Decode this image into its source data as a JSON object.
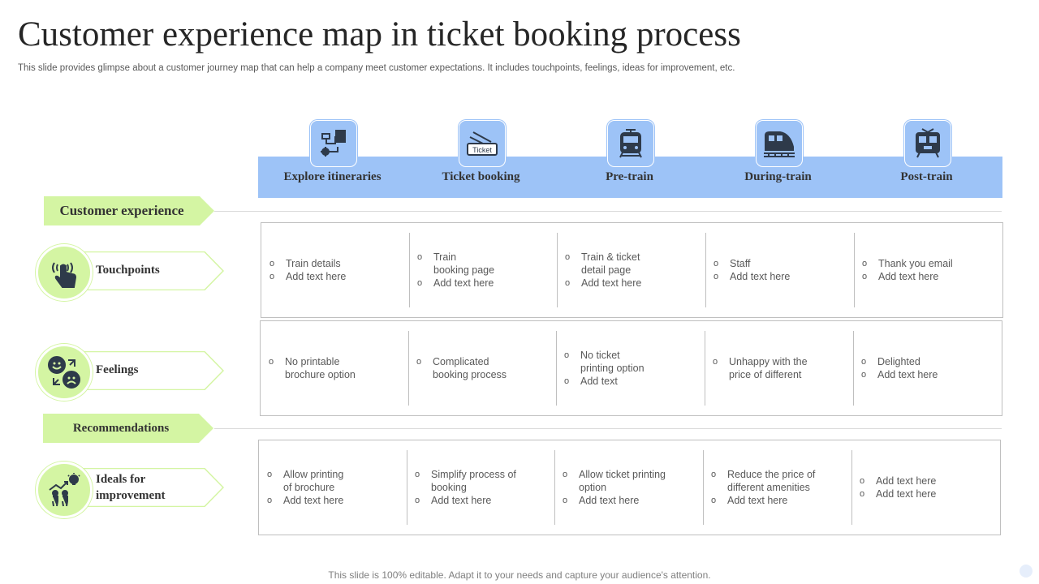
{
  "header": {
    "title": "Customer experience map in ticket booking process",
    "subtitle": "This slide provides glimpse about a customer journey map that can help a company meet customer expectations. It includes touchpoints, feelings, ideas for improvement, etc."
  },
  "stages": [
    {
      "label": "Explore itineraries",
      "icon": "itinerary-map-icon"
    },
    {
      "label": "Ticket booking",
      "icon": "ticket-icon"
    },
    {
      "label": "Pre-train",
      "icon": "train-front-icon"
    },
    {
      "label": "During-train",
      "icon": "moving-train-icon"
    },
    {
      "label": "Post-train",
      "icon": "arriving-train-icon"
    }
  ],
  "sections": {
    "customer_experience": "Customer experience",
    "recommendations": "Recommendations"
  },
  "rows": [
    {
      "label": "Touchpoints",
      "icon": "hand-touch-icon",
      "cells": [
        [
          "Train details",
          "Add text here"
        ],
        [
          "Train\nbooking page",
          "Add text here"
        ],
        [
          "Train & ticket\ndetail page",
          "Add text here"
        ],
        [
          "Staff",
          "Add text here"
        ],
        [
          "Thank you email",
          "Add text here"
        ]
      ]
    },
    {
      "label": "Feelings",
      "icon": "emotions-icon",
      "cells": [
        [
          "No printable\nbrochure option"
        ],
        [
          "Complicated\nbooking process"
        ],
        [
          "No ticket\nprinting option",
          "Add text"
        ],
        [
          "Unhappy with the\nprice of different"
        ],
        [
          "Delighted",
          "Add text here"
        ]
      ]
    },
    {
      "label": "Ideals for\nimprovement",
      "icon": "growth-people-icon",
      "cells": [
        [
          "Allow printing\nof brochure",
          "Add text here"
        ],
        [
          "Simplify process of\nbooking",
          "Add text here"
        ],
        [
          "Allow ticket printing\noption",
          "Add text here"
        ],
        [
          "Reduce the price of\ndifferent amenities",
          "Add text here"
        ],
        [
          "Add text here",
          "Add text here"
        ]
      ]
    }
  ],
  "footer": "This slide is 100% editable. Adapt it to your needs and capture your audience's attention.",
  "colors": {
    "blue": "#9dc3f7",
    "green": "#d4f5a3",
    "icon": "#2e3a4a"
  }
}
